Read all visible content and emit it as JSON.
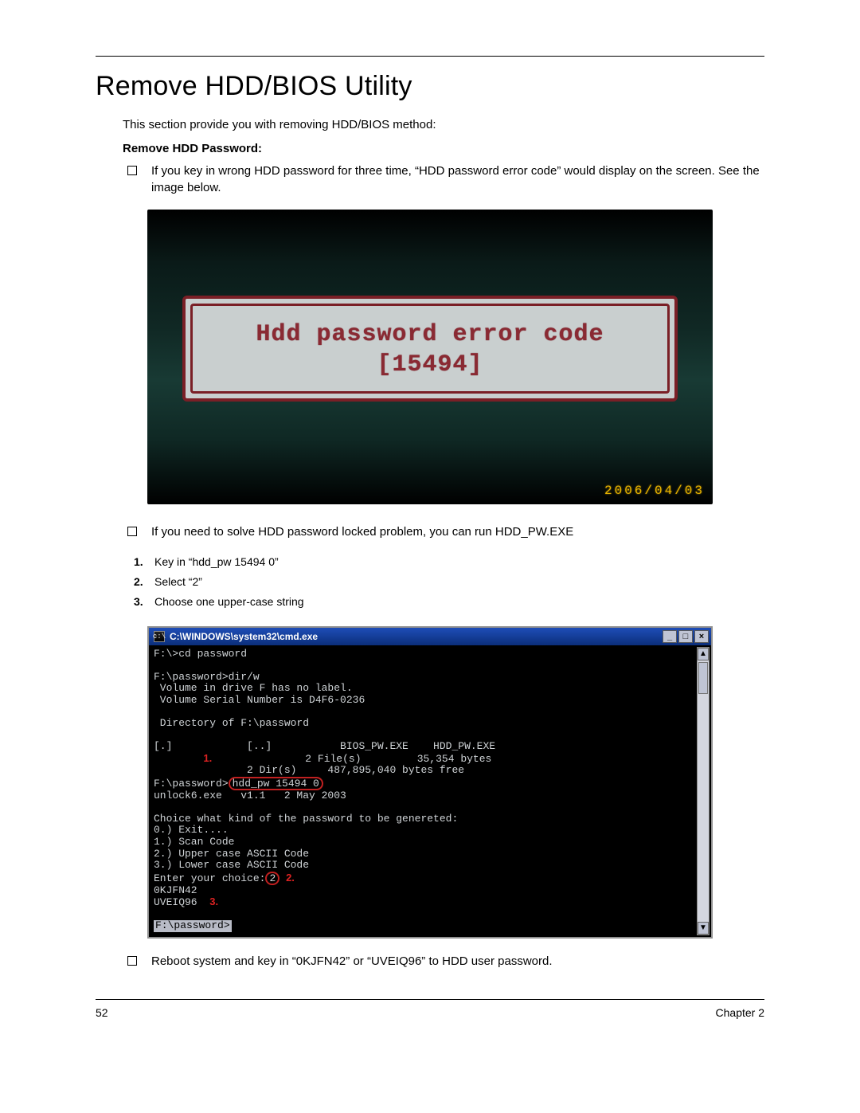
{
  "title": "Remove HDD/BIOS Utility",
  "intro": "This section provide you with removing HDD/BIOS method:",
  "subhead": "Remove HDD Password:",
  "bullets1": [
    "If you key in wrong HDD password for three time, “HDD password error code” would display on the screen. See the image below."
  ],
  "photo1": {
    "line1": "Hdd password error code",
    "line2": "[15494]",
    "date": "2006/04/03"
  },
  "bullets2": [
    "If you need to solve HDD password locked problem, you can run HDD_PW.EXE"
  ],
  "steps": [
    "Key in “hdd_pw 15494 0”",
    "Select “2”",
    "Choose one upper-case string"
  ],
  "cmd": {
    "title": "C:\\WINDOWS\\system32\\cmd.exe",
    "winbtns": {
      "min": "_",
      "max": "□",
      "close": "×"
    },
    "lines": {
      "l0": "F:\\>cd password",
      "l1": "",
      "l2": "F:\\password>dir/w",
      "l3": " Volume in drive F has no label.",
      "l4": " Volume Serial Number is D4F6-0236",
      "l5": "",
      "l6": " Directory of F:\\password",
      "l7": "",
      "l8": "[.]            [..]           BIOS_PW.EXE    HDD_PW.EXE",
      "l9a": "               2 File(s)         35,354 bytes",
      "l9b": "               2 Dir(s)     487,895,040 bytes free",
      "l10a": "F:\\password>",
      "l10b": "hdd_pw 15494 0",
      "l11": "unlock6.exe   v1.1   2 May 2003",
      "l12": "",
      "l13": "Choice what kind of the password to be genereted:",
      "l14": "0.) Exit....",
      "l15": "1.) Scan Code",
      "l16": "2.) Upper case ASCII Code",
      "l17": "3.) Lower case ASCII Code",
      "l18a": "Enter your choice:",
      "l18b": "2",
      "l19": "0KJFN42",
      "l20": "UVEIQ96",
      "l21": "",
      "l22": "F:\\password>"
    },
    "labels": {
      "a": "1.",
      "b": "2.",
      "c": "3."
    }
  },
  "bullets3": [
    "Reboot system and key in “0KJFN42” or “UVEIQ96” to HDD user password."
  ],
  "footer": {
    "page": "52",
    "chapter": "Chapter 2"
  }
}
